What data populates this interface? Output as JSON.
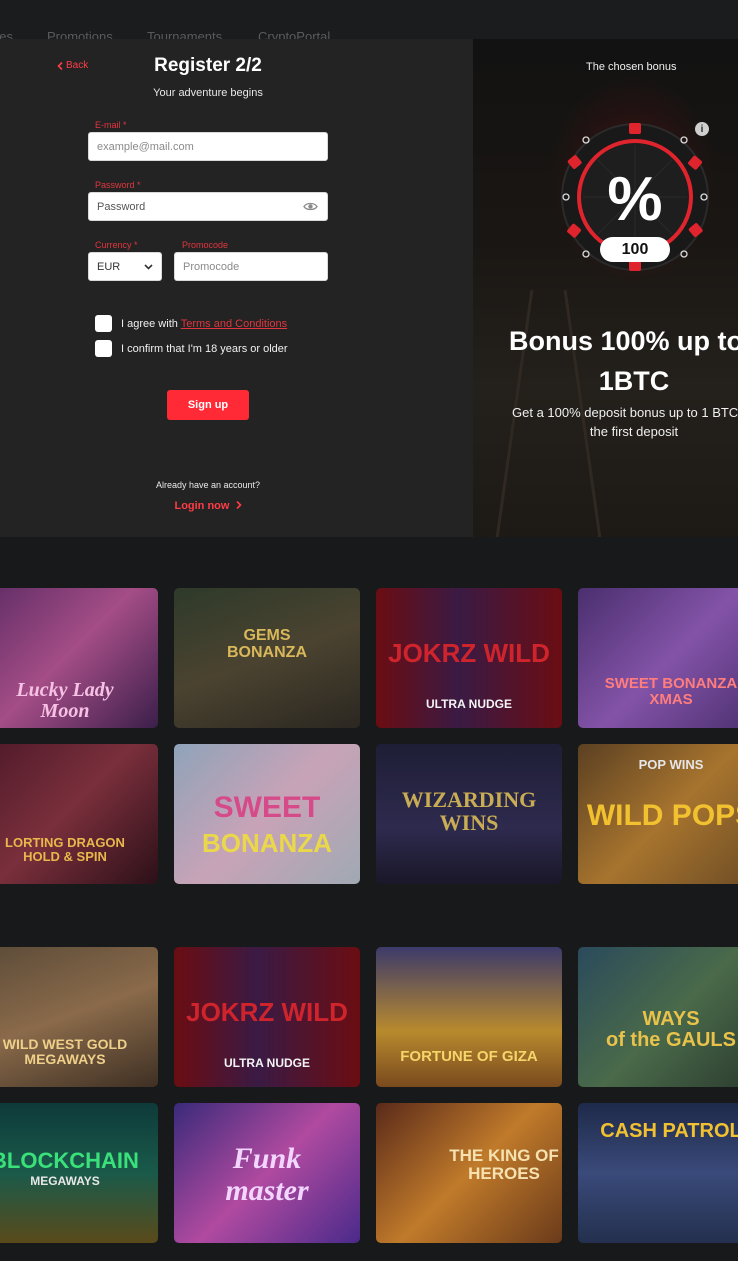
{
  "top_nav": [
    "nes",
    "Promotions",
    "Tournaments",
    "CryptoPortal"
  ],
  "form": {
    "back_label": "Back",
    "title": "Register 2/2",
    "subtitle": "Your adventure begins",
    "email_label": "E-mail *",
    "email_placeholder": "example@mail.com",
    "password_label": "Password *",
    "password_placeholder": "Password",
    "currency_label": "Currency *",
    "currency_value": "EUR",
    "promocode_label": "Promocode",
    "promocode_placeholder": "Promocode",
    "terms_prefix": "I agree with ",
    "terms_link": "Terms and Conditions",
    "age_text": "I confirm that I'm 18 years or older",
    "signup_label": "Sign up",
    "already_text": "Already have an account?",
    "login_label": "Login now"
  },
  "bonus": {
    "chosen_label": "The chosen bonus",
    "percent_symbol": "%",
    "amount": "100",
    "headline_line1": "Bonus 100% up to",
    "headline_line2": "1BTC",
    "desc_line1": "Get a 100% deposit bonus up to 1 BTC",
    "desc_line2": "the first deposit",
    "info_symbol": "i",
    "accent_color": "#e0242d"
  },
  "games": [
    {
      "title_1": "Lucky Lady",
      "title_2": "Moon"
    },
    {
      "title_1": "GEMS",
      "title_2": "BONANZA"
    },
    {
      "title_1": "JOKRZ WILD",
      "title_2": "ULTRA NUDGE"
    },
    {
      "title_1": "SWEET BONANZA",
      "title_2": "XMAS"
    },
    {
      "title_1": "LORTING DRAGON",
      "title_2": "HOLD & SPIN"
    },
    {
      "title_1": "SWEET",
      "title_2": "BONANZA"
    },
    {
      "title_1": "WIZARDING",
      "title_2": "WINS"
    },
    {
      "title_1": "POP WINS",
      "title_2": "WILD POPS"
    },
    {
      "title_1": "WILD WEST GOLD",
      "title_2": "MEGAWAYS"
    },
    {
      "title_1": "JOKRZ WILD",
      "title_2": "ULTRA NUDGE"
    },
    {
      "title_1": "FORTUNE OF GIZA",
      "title_2": ""
    },
    {
      "title_1": "WAYS",
      "title_2": "of the GAULS"
    },
    {
      "title_1": "BLOCKCHAIN",
      "title_2": "MEGAWAYS"
    },
    {
      "title_1": "Funk",
      "title_2": "master"
    },
    {
      "title_1": "THE KING OF",
      "title_2": "HEROES"
    },
    {
      "title_1": "CASH PATROL",
      "title_2": ""
    }
  ]
}
